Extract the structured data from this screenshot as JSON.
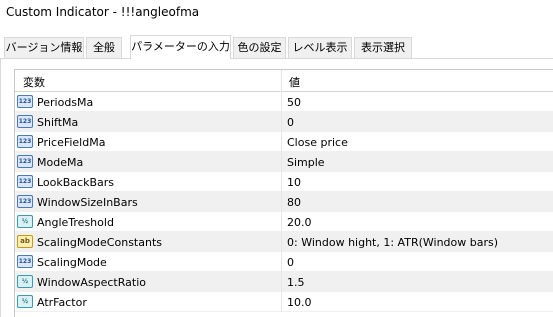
{
  "window": {
    "title": "Custom Indicator - !!!angleofma"
  },
  "tabs": [
    {
      "label": "バージョン情報",
      "active": false
    },
    {
      "label": "全般",
      "active": false
    },
    {
      "label": "パラメーターの入力",
      "active": true
    },
    {
      "label": "色の設定",
      "active": false
    },
    {
      "label": "レベル表示",
      "active": false
    },
    {
      "label": "表示選択",
      "active": false
    }
  ],
  "grid": {
    "columns": {
      "name": "変数",
      "value": "値"
    },
    "rows": [
      {
        "icon": "123",
        "type": "integer-icon",
        "name": "PeriodsMa",
        "value": "50"
      },
      {
        "icon": "123",
        "type": "integer-icon",
        "name": "ShiftMa",
        "value": "0"
      },
      {
        "icon": "123",
        "type": "integer-icon",
        "name": "PriceFieldMa",
        "value": "Close price"
      },
      {
        "icon": "123",
        "type": "integer-icon",
        "name": "ModeMa",
        "value": "Simple"
      },
      {
        "icon": "123",
        "type": "integer-icon",
        "name": "LookBackBars",
        "value": "10"
      },
      {
        "icon": "123",
        "type": "integer-icon",
        "name": "WindowSizeInBars",
        "value": "80"
      },
      {
        "icon": "½",
        "type": "double-icon",
        "name": "AngleTreshold",
        "value": "20.0"
      },
      {
        "icon": "ab",
        "type": "string-icon",
        "name": "ScalingModeConstants",
        "value": "0: Window hight, 1: ATR(Window bars)"
      },
      {
        "icon": "123",
        "type": "integer-icon",
        "name": "ScalingMode",
        "value": "0"
      },
      {
        "icon": "½",
        "type": "double-icon",
        "name": "WindowAspectRatio",
        "value": "1.5"
      },
      {
        "icon": "½",
        "type": "double-icon",
        "name": "AtrFactor",
        "value": "10.0"
      }
    ]
  },
  "colors": {
    "row_alt": "#f0f0f0",
    "integer_icon": "#4a78b8",
    "double_icon": "#3a9aae",
    "string_icon": "#c79a16"
  }
}
